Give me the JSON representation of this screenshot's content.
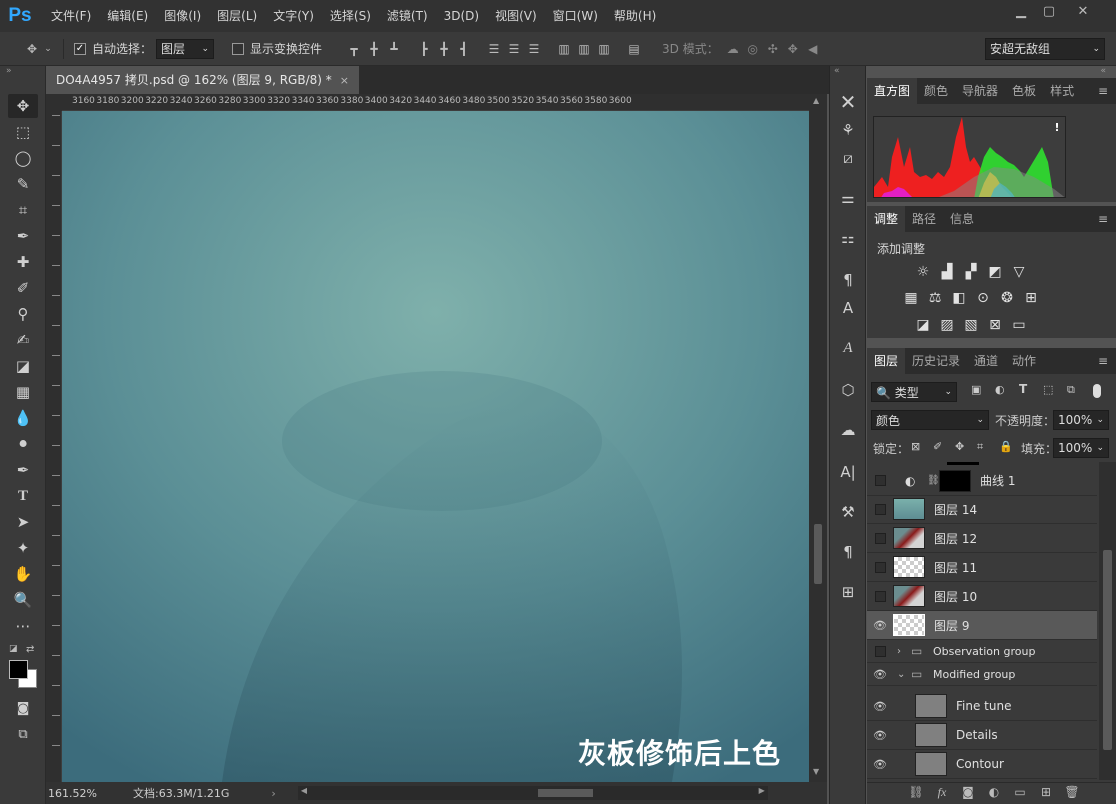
{
  "app": {
    "logo": "Ps"
  },
  "menu": [
    "文件(F)",
    "编辑(E)",
    "图像(I)",
    "图层(L)",
    "文字(Y)",
    "选择(S)",
    "滤镜(T)",
    "3D(D)",
    "视图(V)",
    "窗口(W)",
    "帮助(H)"
  ],
  "options": {
    "auto_select_label": "自动选择：",
    "auto_select_value": "图层",
    "show_transform_label": "显示变换控件",
    "mode_3d_label": "3D 模式：",
    "workspace": "安超无敌组"
  },
  "document": {
    "tab_title": "DO4A4957 拷贝.psd @ 162% (图层 9, RGB/8) *",
    "zoom": "161.52%",
    "doc_info": "文档:63.3M/1.21G",
    "caption": "灰板修饰后上色",
    "ruler_h": [
      "3160",
      "3180",
      "3200",
      "3220",
      "3240",
      "3260",
      "3280",
      "3300",
      "3320",
      "3340",
      "3360",
      "3380",
      "3400",
      "3420",
      "3440",
      "3460",
      "3480",
      "3500",
      "3520",
      "3540",
      "3560",
      "3580",
      "3600"
    ]
  },
  "histogram": {
    "tabs": [
      "直方图",
      "颜色",
      "导航器",
      "色板",
      "样式"
    ],
    "warning": "!"
  },
  "adjustments": {
    "tabs": [
      "调整",
      "路径",
      "信息"
    ],
    "title": "添加调整"
  },
  "layers": {
    "tabs": [
      "图层",
      "历史记录",
      "通道",
      "动作"
    ],
    "filter_kind": "类型",
    "blend_mode": "颜色",
    "opacity_label": "不透明度：",
    "opacity": "100%",
    "lock_label": "锁定：",
    "fill_label": "填充：",
    "fill": "100%",
    "items": [
      {
        "name": "曲线 1",
        "visible": false,
        "type": "adjustment"
      },
      {
        "name": "图层 14",
        "visible": false,
        "type": "pixel"
      },
      {
        "name": "图层 12",
        "visible": false,
        "type": "pixel"
      },
      {
        "name": "图层 11",
        "visible": false,
        "type": "pixel"
      },
      {
        "name": "图层 10",
        "visible": false,
        "type": "pixel"
      },
      {
        "name": "图层 9",
        "visible": true,
        "type": "pixel",
        "selected": true
      },
      {
        "name": "Observation group",
        "visible": false,
        "type": "group"
      },
      {
        "name": "Modified group",
        "visible": true,
        "type": "group"
      },
      {
        "name": "Fine tune",
        "visible": true,
        "type": "pixel"
      },
      {
        "name": "Details",
        "visible": true,
        "type": "pixel"
      },
      {
        "name": "Contour",
        "visible": true,
        "type": "pixel"
      }
    ]
  },
  "colors": {
    "accent": "#31a8ff",
    "canvas_bg": "#6f9e9d",
    "foreground": "#000000",
    "background": "#ffffff"
  }
}
